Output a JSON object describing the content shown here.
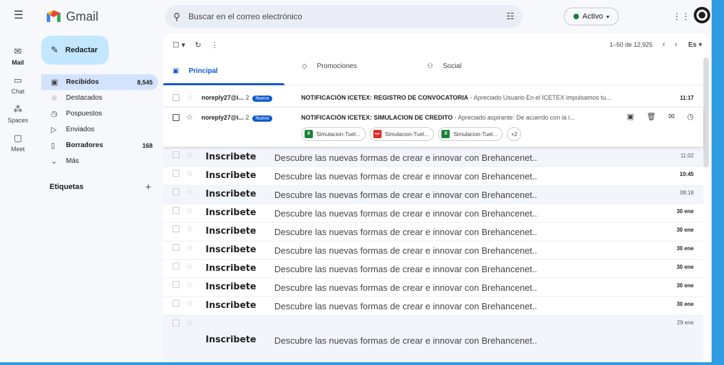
{
  "app": {
    "name": "Gmail"
  },
  "rail": [
    {
      "label": "Mail",
      "icon": "mail-icon",
      "glyph": "✉",
      "active": true
    },
    {
      "label": "Chat",
      "icon": "chat-icon",
      "glyph": "▭",
      "active": false
    },
    {
      "label": "Spaces",
      "icon": "spaces-icon",
      "glyph": "⁂",
      "active": false
    },
    {
      "label": "Meet",
      "icon": "meet-icon",
      "glyph": "▢",
      "active": false
    }
  ],
  "search": {
    "placeholder": "Buscar en el correo electrónico"
  },
  "status": {
    "label": "Activo"
  },
  "compose": {
    "label": "Redactar"
  },
  "nav": [
    {
      "label": "Recibidos",
      "count": "8,545",
      "icon": "inbox-icon",
      "glyph": "▣",
      "selected": true,
      "bold": true
    },
    {
      "label": "Destacados",
      "count": "",
      "icon": "star-icon",
      "glyph": "☆",
      "selected": false,
      "bold": false
    },
    {
      "label": "Pospuestos",
      "count": "",
      "icon": "clock-icon",
      "glyph": "◷",
      "selected": false,
      "bold": false
    },
    {
      "label": "Enviados",
      "count": "",
      "icon": "send-icon",
      "glyph": "▷",
      "selected": false,
      "bold": false
    },
    {
      "label": "Borradores",
      "count": "168",
      "icon": "draft-icon",
      "glyph": "▯",
      "selected": false,
      "bold": true
    },
    {
      "label": "Más",
      "count": "",
      "icon": "chevron-down-icon",
      "glyph": "⌄",
      "selected": false,
      "bold": false
    }
  ],
  "labels_section": {
    "label": "Etiquetas"
  },
  "toolbar": {
    "pager": "1–50 de 12,925",
    "lang": "Es"
  },
  "tabs": [
    {
      "label": "Principal",
      "icon": "inbox-icon",
      "glyph": "▣"
    },
    {
      "label": "Promociones",
      "icon": "tag-icon",
      "glyph": "◇"
    },
    {
      "label": "Social",
      "icon": "people-icon",
      "glyph": "⚇"
    }
  ],
  "emails": [
    {
      "sender": "noreply27@i...",
      "count": "2",
      "badge": "Nuevo",
      "subject": "NOTIFICACIÓN ICETEX: REGISTRO DE CONVOCATORIA",
      "snippet": " - Apreciado Usuario En el ICETEX impulsamos tu...",
      "time": "11:17"
    },
    {
      "sender": "noreply27@i...",
      "count": "2",
      "badge": "Nuevo",
      "subject": "NOTIFICACIÓN ICETEX: SIMULACION DE CREDITO",
      "snippet": " - Apreciado aspirante: De acuerdo con la i...",
      "attachments": [
        {
          "name": "Simulacion-Tuel...",
          "type": "xls",
          "color": "#188038",
          "glyph": "X"
        },
        {
          "name": "Simulacion-Tuel...",
          "type": "pdf",
          "color": "#d93025",
          "glyph": "PDF"
        },
        {
          "name": "Simulacion-Tuel...",
          "type": "xls",
          "color": "#188038",
          "glyph": "X"
        }
      ],
      "more": "+2"
    }
  ],
  "promos": [
    {
      "sender": "Inscribete",
      "subject": "Descubre las nuevas formas de crear e innovar con Brehancenet..",
      "time": "11:02",
      "read": true,
      "shade": true
    },
    {
      "sender": "Inscribete",
      "subject": "Descubre las nuevas formas de crear e innovar con Brehancenet..",
      "time": "10:45",
      "read": false,
      "shade": false
    },
    {
      "sender": "Inscribete",
      "subject": "Descubre las nuevas formas de crear e innovar con Brehancenet..",
      "time": "08:18",
      "read": true,
      "shade": true
    },
    {
      "sender": "Inscribete",
      "subject": "Descubre las nuevas formas de crear e innovar con Brehancenet..",
      "time": "30 ene",
      "read": false,
      "shade": false
    },
    {
      "sender": "Inscribete",
      "subject": "Descubre las nuevas formas de crear e innovar con Brehancenet..",
      "time": "30 ene",
      "read": false,
      "shade": false
    },
    {
      "sender": "Inscribete",
      "subject": "Descubre las nuevas formas de crear e innovar con Brehancenet..",
      "time": "30 ene",
      "read": false,
      "shade": false
    },
    {
      "sender": "Inscribete",
      "subject": "Descubre las nuevas formas de crear e innovar con Brehancenet..",
      "time": "30 ene",
      "read": false,
      "shade": false
    },
    {
      "sender": "Inscribete",
      "subject": "Descubre las nuevas formas de crear e innovar con Brehancenet..",
      "time": "30 ene",
      "read": false,
      "shade": false
    },
    {
      "sender": "Inscribete",
      "subject": "Descubre las nuevas formas de crear e innovar con Brehancenet..",
      "time": "30 ene",
      "read": false,
      "shade": false
    },
    {
      "sender": "Inscribete",
      "subject": "Descubre las nuevas formas de crear e innovar con Brehancenet..",
      "time": "29 ene",
      "read": true,
      "shade": true
    }
  ],
  "colors": {
    "accent": "#0b57d0",
    "compose": "#c2e7ff",
    "selected_nav": "#d3e3fd",
    "frame": "#2f9be0"
  }
}
